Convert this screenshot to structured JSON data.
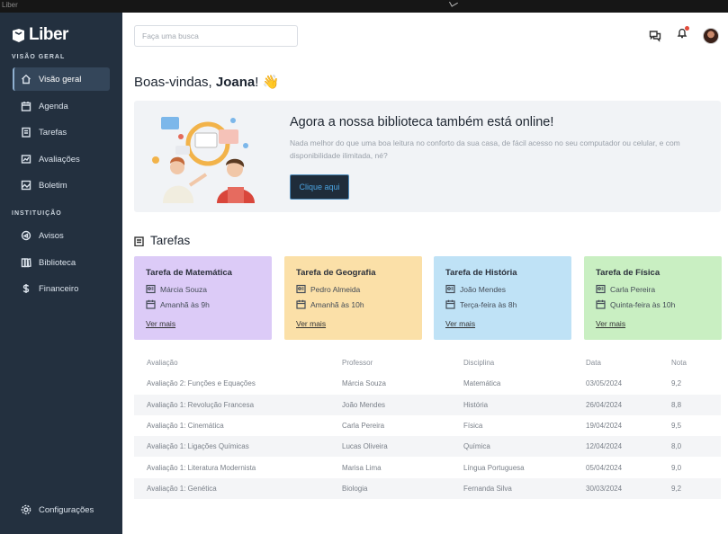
{
  "window": {
    "title": "Liber"
  },
  "app": {
    "logo_text": "Liber"
  },
  "sidebar": {
    "section_overview": "VISÃO GERAL",
    "section_institution": "INSTITUIÇÃO",
    "items": [
      {
        "label": "Visão geral",
        "icon": "home-icon"
      },
      {
        "label": "Agenda",
        "icon": "calendar-icon"
      },
      {
        "label": "Tarefas",
        "icon": "task-icon"
      },
      {
        "label": "Avaliações",
        "icon": "chart-icon"
      },
      {
        "label": "Boletim",
        "icon": "report-icon"
      },
      {
        "label": "Avisos",
        "icon": "megaphone-icon"
      },
      {
        "label": "Biblioteca",
        "icon": "library-icon"
      },
      {
        "label": "Financeiro",
        "icon": "dollar-icon"
      }
    ],
    "settings_label": "Configurações"
  },
  "header": {
    "search_placeholder": "Faça uma busca"
  },
  "welcome": {
    "greeting": "Boas-vindas,",
    "name": "Joana",
    "emoji": "👋"
  },
  "banner": {
    "title": "Agora a nossa biblioteca também está online!",
    "text": "Nada melhor do que uma boa leitura no conforto da sua casa, de fácil acesso no seu computador ou celular, e com disponibilidade ilimitada, né?",
    "button": "Clique aqui"
  },
  "tasks": {
    "title": "Tarefas",
    "cards": [
      {
        "title": "Tarefa de Matemática",
        "teacher": "Márcia Souza",
        "due": "Amanhã às 9h",
        "link": "Ver mais",
        "color": "#dccbf7"
      },
      {
        "title": "Tarefa de Geografia",
        "teacher": "Pedro Almeida",
        "due": "Amanhã às 10h",
        "link": "Ver mais",
        "color": "#fbe0a8"
      },
      {
        "title": "Tarefa de História",
        "teacher": "João Mendes",
        "due": "Terça-feira às 8h",
        "link": "Ver mais",
        "color": "#bfe2f6"
      },
      {
        "title": "Tarefa de Física",
        "teacher": "Carla Pereira",
        "due": "Quinta-feira às 10h",
        "link": "Ver mais",
        "color": "#c9efc2"
      }
    ]
  },
  "grades": {
    "headers": [
      "Avaliação",
      "Professor",
      "Disciplina",
      "Data",
      "Nota"
    ],
    "rows": [
      [
        "Avaliação 2: Funções e Equações",
        "Márcia Souza",
        "Matemática",
        "03/05/2024",
        "9,2"
      ],
      [
        "Avaliação 1: Revolução Francesa",
        "João Mendes",
        "História",
        "26/04/2024",
        "8,8"
      ],
      [
        "Avaliação 1: Cinemática",
        "Carla Pereira",
        "Física",
        "19/04/2024",
        "9,5"
      ],
      [
        "Avaliação 1: Ligações Químicas",
        "Lucas Oliveira",
        "Química",
        "12/04/2024",
        "8,0"
      ],
      [
        "Avaliação 1: Literatura Modernista",
        "Marisa Lima",
        "Língua Portuguesa",
        "05/04/2024",
        "9,0"
      ],
      [
        "Avaliação 1: Genética",
        "Biologia",
        "Fernanda Silva",
        "30/03/2024",
        "9,2"
      ]
    ]
  }
}
